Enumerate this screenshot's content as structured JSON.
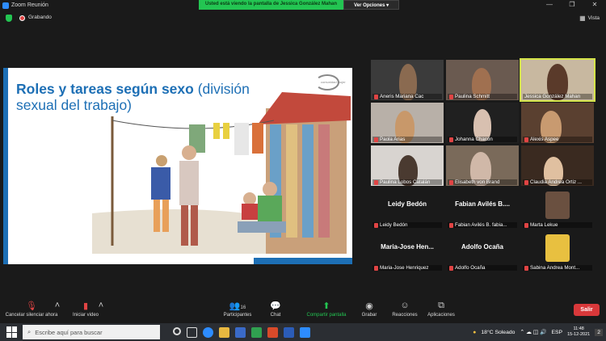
{
  "window": {
    "title": "Zoom Reunión"
  },
  "share_banner": {
    "message": "Usted está viendo la pantalla de Jessica González Mahan",
    "view_options": "Ver Opciones"
  },
  "recording": {
    "label": "Grabando"
  },
  "view": {
    "label": "Vista"
  },
  "slide": {
    "title_bold": "Roles y tareas según sexo",
    "title_rest": " (división sexual del trabajo)",
    "logo_text": "comunidad mujer"
  },
  "participants": [
    {
      "name": "Aneris Mariana Cac",
      "muted": true
    },
    {
      "name": "Paulina Schmitt",
      "muted": true
    },
    {
      "name": "Jessica González Mahan",
      "muted": false,
      "active": true
    },
    {
      "name": "Paola Arias",
      "muted": true
    },
    {
      "name": "Johanna Chacón",
      "muted": true
    },
    {
      "name": "Alexis Aspee",
      "muted": true
    },
    {
      "name": "Paulina Lobos Catalán",
      "muted": true
    },
    {
      "name": "Elisabeth von Brand",
      "muted": true
    },
    {
      "name": "Claudia Andrea Ortiz ...",
      "muted": true
    },
    {
      "name": "Leidy Bedón",
      "muted": true,
      "big": "Leidy Bedón"
    },
    {
      "name": "Fabian Avilés B. fabia...",
      "muted": true,
      "big": "Fabian Avilés B...."
    },
    {
      "name": "Marta Lekue",
      "muted": true
    },
    {
      "name": "Maria-Jose Henriquez",
      "muted": true,
      "big": "Maria-Jose Hen..."
    },
    {
      "name": "Adolfo Ocaña",
      "muted": true,
      "big": "Adolfo Ocaña"
    },
    {
      "name": "Sabina Andrea Mont...",
      "muted": true
    }
  ],
  "toolbar": {
    "mute": "Cancelar silenciar ahora",
    "video": "Iniciar video",
    "participants": "Participantes",
    "participants_count": "16",
    "chat": "Chat",
    "share": "Compartir pantalla",
    "record": "Grabar",
    "reactions": "Reacciones",
    "apps": "Aplicaciones",
    "leave": "Salir"
  },
  "taskbar": {
    "search_placeholder": "Escribe aquí para buscar",
    "weather": "18°C  Soleado",
    "lang": "ESP",
    "time": "11:48",
    "date": "15-12-2021",
    "notif": "2"
  },
  "colors": {
    "accent": "#2d8cff",
    "share_green": "#23c552",
    "leave_red": "#d8383a",
    "slide_blue": "#1d6fb5"
  }
}
